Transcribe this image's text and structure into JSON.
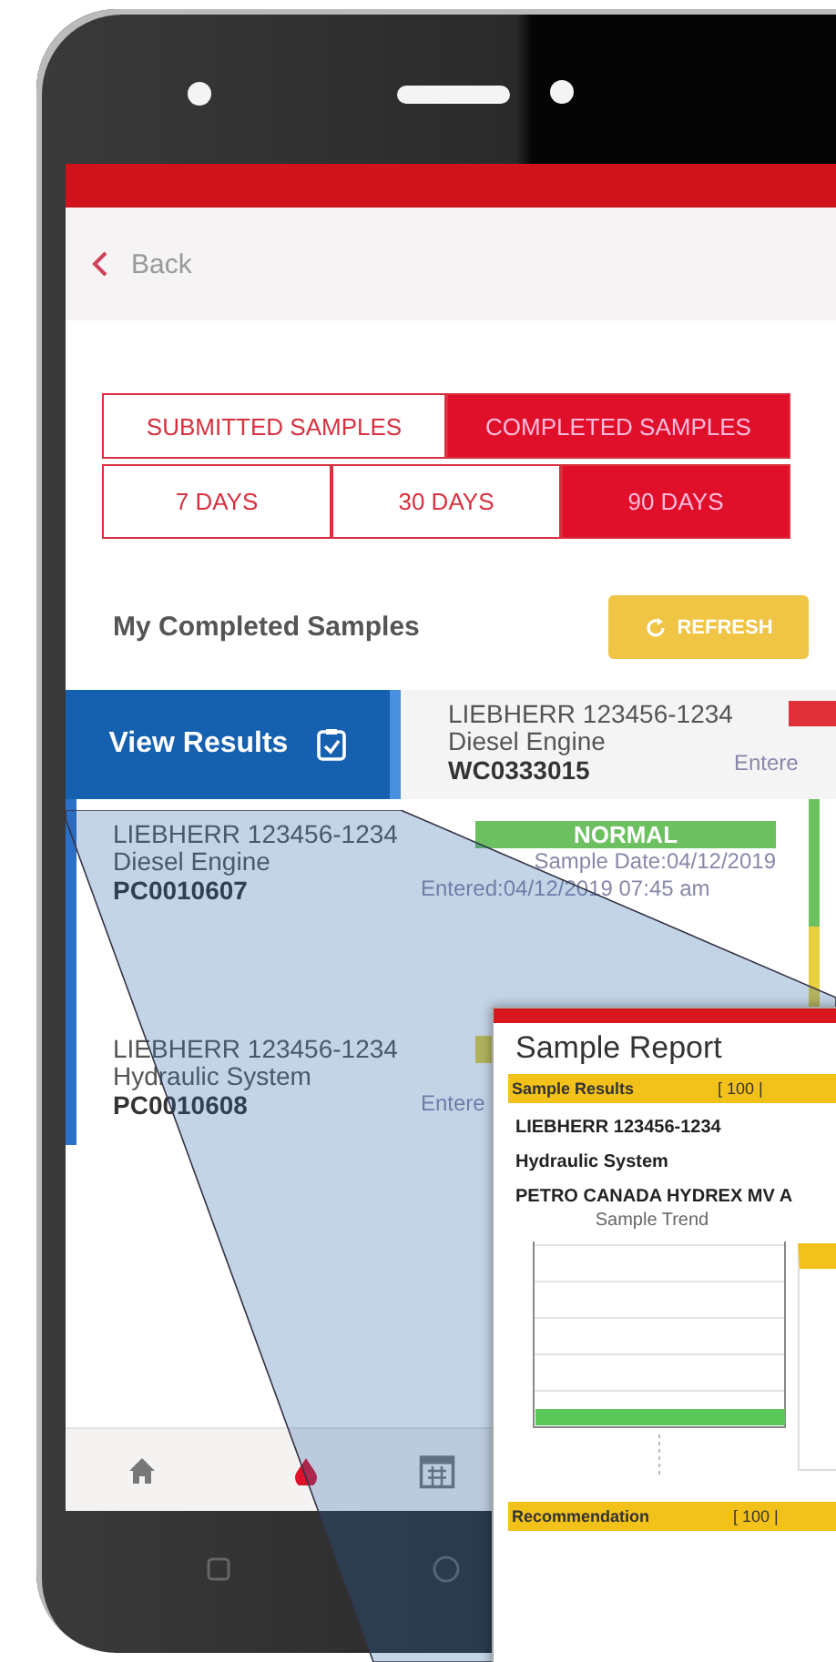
{
  "header": {
    "back": "Back"
  },
  "sample_tabs": [
    {
      "label": "SUBMITTED SAMPLES",
      "selected": false
    },
    {
      "label": "COMPLETED SAMPLES",
      "selected": true
    }
  ],
  "period_tabs": [
    {
      "label": "7 DAYS",
      "selected": false
    },
    {
      "label": "30 DAYS",
      "selected": false
    },
    {
      "label": "90 DAYS",
      "selected": true
    }
  ],
  "section_title": "My Completed Samples",
  "refresh_button": "REFRESH",
  "samples": [
    {
      "equipment": "LIEBHERR 123456-1234",
      "component": "Diesel Engine",
      "sample_id": "WC0333015",
      "entered": "Entere",
      "color": "#e0303a",
      "action": "View Results"
    },
    {
      "equipment": "LIEBHERR 123456-1234",
      "component": "Diesel Engine",
      "sample_id": "PC0010607",
      "status": "NORMAL",
      "sample_date": "Sample Date:04/12/2019",
      "entered": "Entered:04/12/2019 07:45 am",
      "color": "#6cc060"
    },
    {
      "equipment": "LIEBHERR 123456-1234",
      "component": "Hydraulic System",
      "sample_id": "PC0010608",
      "entered": "Entere",
      "color": "#e8d040"
    }
  ],
  "nav": [
    {
      "kind": "home",
      "selected": false
    },
    {
      "kind": "drop",
      "selected": true
    },
    {
      "kind": "calendar",
      "selected": false
    }
  ],
  "report": {
    "title": "Sample Report",
    "results_bar": {
      "label": "Sample Results",
      "range": "[ 100 |"
    },
    "equipment": "LIEBHERR 123456-1234",
    "component": "Hydraulic System",
    "fluid": "PETRO CANADA HYDREX MV A",
    "trend_title": "Sample Trend",
    "recommendation_bar": {
      "label": "Recommendation",
      "range": "[ 100 |"
    }
  }
}
